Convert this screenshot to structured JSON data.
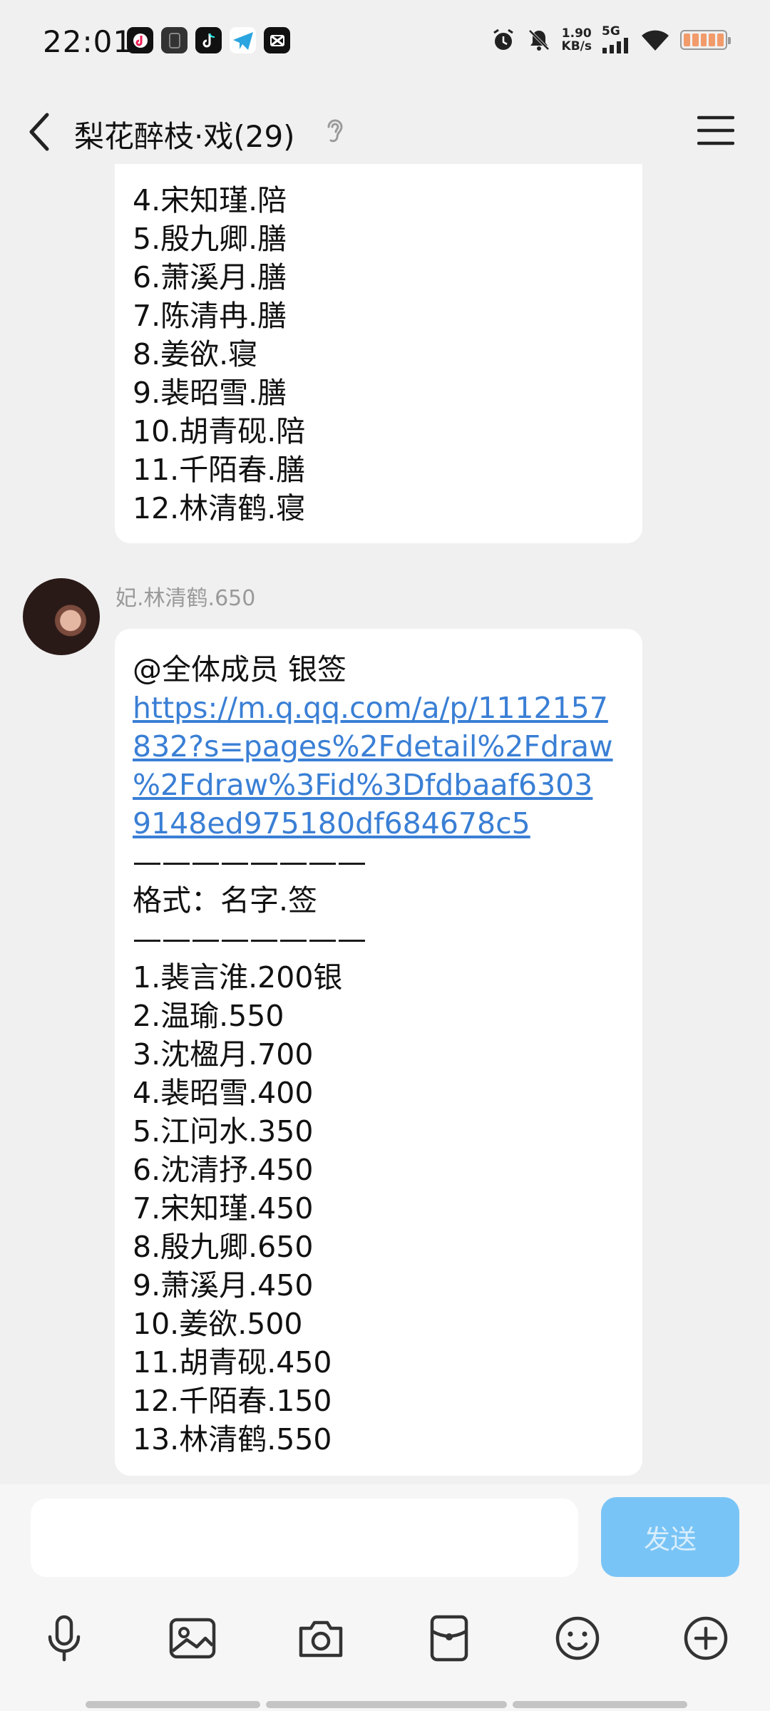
{
  "status_bar": {
    "time": "22:01",
    "app_icons": [
      "tiktok-lite-icon",
      "notes-icon",
      "tiktok-icon",
      "telegram-icon",
      "capcut-icon"
    ],
    "speed_value": "1.90",
    "speed_unit": "KB/s",
    "network": "5G",
    "icons": [
      "alarm-icon",
      "mute-icon",
      "signal-icon",
      "wifi-icon",
      "battery-icon"
    ]
  },
  "header": {
    "title": "梨花醉枝·戏(29)",
    "back_icon": "chevron-left-icon",
    "ear_icon": "ear-icon",
    "menu_icon": "hamburger-menu-icon"
  },
  "messages": [
    {
      "lines": [
        "4.宋知瑾.陪",
        "5.殷九卿.膳",
        "6.萧溪月.膳",
        "7.陈清冉.膳",
        "8.姜欲.寝",
        "9.裴昭雪.膳",
        "10.胡青砚.陪",
        "11.千陌春.膳",
        "12.林清鹤.寝"
      ]
    },
    {
      "sender": "妃.林清鹤.650",
      "intro": "@全体成员 银签",
      "link": "https://m.q.qq.com/a/p/1112157832?s=pages%2Fdetail%2Fdraw%2Fdraw%3Fid%3Dfdbaaf63039148ed975180df684678c5",
      "link_lines": [
        "https://m.q.qq.com/a/p/1112157",
        "832?s=pages%2Fdetail%2Fdraw",
        "%2Fdraw%3Fid%3Dfdbaaf6303",
        "9148ed975180df684678c5"
      ],
      "divider": "————————",
      "format_line": "格式：名字.签",
      "list": [
        "1.裴言淮.200银",
        "2.温瑜.550",
        "3.沈楹月.700",
        "4.裴昭雪.400",
        "5.江问水.350",
        "6.沈清抒.450",
        "7.宋知瑾.450",
        "8.殷九卿.650",
        "9.萧溪月.450",
        "10.姜欲.500",
        "11.胡青砚.450",
        "12.千陌春.150",
        "13.林清鹤.550"
      ]
    }
  ],
  "input": {
    "placeholder": "",
    "send_label": "发送"
  },
  "toolbar": [
    "microphone-icon",
    "image-icon",
    "camera-icon",
    "red-packet-icon",
    "emoji-icon",
    "plus-icon"
  ],
  "colors": {
    "background": "#f0f0f0",
    "link": "#3a7fd5",
    "send_button": "#79c4f6",
    "bubble": "#ffffff"
  }
}
